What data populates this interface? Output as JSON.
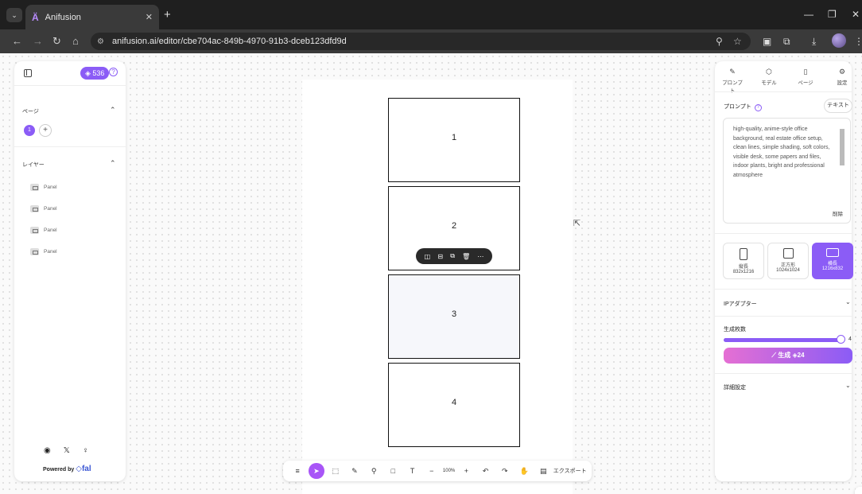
{
  "browser": {
    "tab_title": "Anifusion",
    "tab_favicon": "Ä",
    "url": "anifusion.ai/editor/cbe704ac-849b-4970-91b3-dceb123dfd9d"
  },
  "left_panel": {
    "credits": "536",
    "pages_title": "ページ",
    "page_number": "1",
    "add_page": "+",
    "layers_title": "レイヤー",
    "layers": [
      "Panel",
      "Panel",
      "Panel",
      "Panel"
    ],
    "powered_by": "Powered by",
    "powered_brand": "◇fal"
  },
  "canvas": {
    "panels": [
      "1",
      "2",
      "3",
      "4"
    ]
  },
  "toolbar": {
    "zoom": "100%",
    "export": "エクスポート"
  },
  "right_panel": {
    "tabs": [
      {
        "label": "プロンプト",
        "icon": "pencil-icon"
      },
      {
        "label": "モデル",
        "icon": "cube-icon"
      },
      {
        "label": "ページ",
        "icon": "file-icon"
      },
      {
        "label": "設定",
        "icon": "gear-icon"
      }
    ],
    "prompt_label": "プロンプト",
    "text_button": "テキスト",
    "prompt_text": "high-quality, anime-style office background, real estate office setup, clean lines, simple shading, soft colors, visible desk, some papers and files, indoor plants, bright and professional atmosphere",
    "delete": "削除",
    "ratios": [
      {
        "name": "縦長",
        "size": "832x1216"
      },
      {
        "name": "正方形",
        "size": "1024x1024"
      },
      {
        "name": "横長",
        "size": "1216x832"
      }
    ],
    "selected_ratio": "横長",
    "ip_adapter": "IPアダプター",
    "count_label": "生成枚数",
    "count_value": "4",
    "count_fill": 1,
    "generate_label": "生成",
    "generate_cost": "24",
    "advanced": "詳細設定"
  },
  "colors": {
    "accent": "#8b5cf6",
    "generate_gradient_start": "#e56fd3"
  }
}
